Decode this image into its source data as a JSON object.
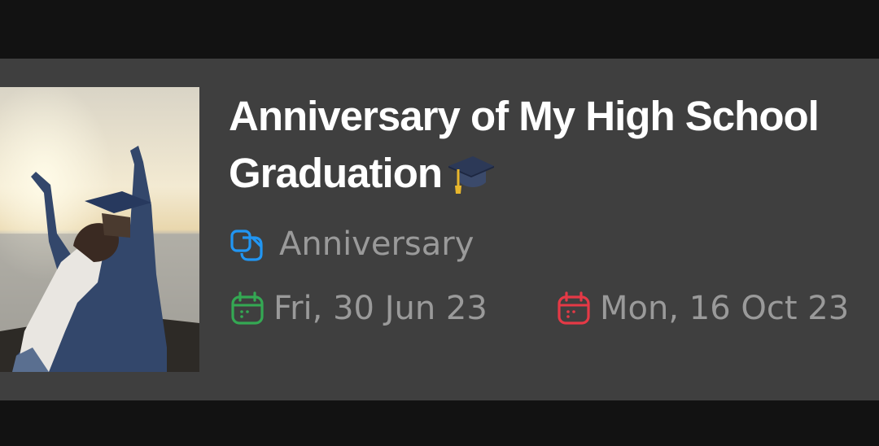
{
  "event": {
    "title": "Anniversary of My High School Graduation",
    "title_emoji_icon": "graduation-cap-icon",
    "category": "Anniversary",
    "category_icon": "copy-icon",
    "start_date": "Fri, 30 Jun 23",
    "end_date": "Mon, 16 Oct 23",
    "start_icon": "calendar-icon",
    "end_icon": "calendar-icon",
    "image_description_icon": "graduation-photo"
  },
  "colors": {
    "background": "#121212",
    "card": "#3f3f3f",
    "title_text": "#ffffff",
    "meta_text": "#9a9a9a",
    "category_icon": "#2196f3",
    "start_icon": "#34a853",
    "end_icon": "#e53946"
  }
}
